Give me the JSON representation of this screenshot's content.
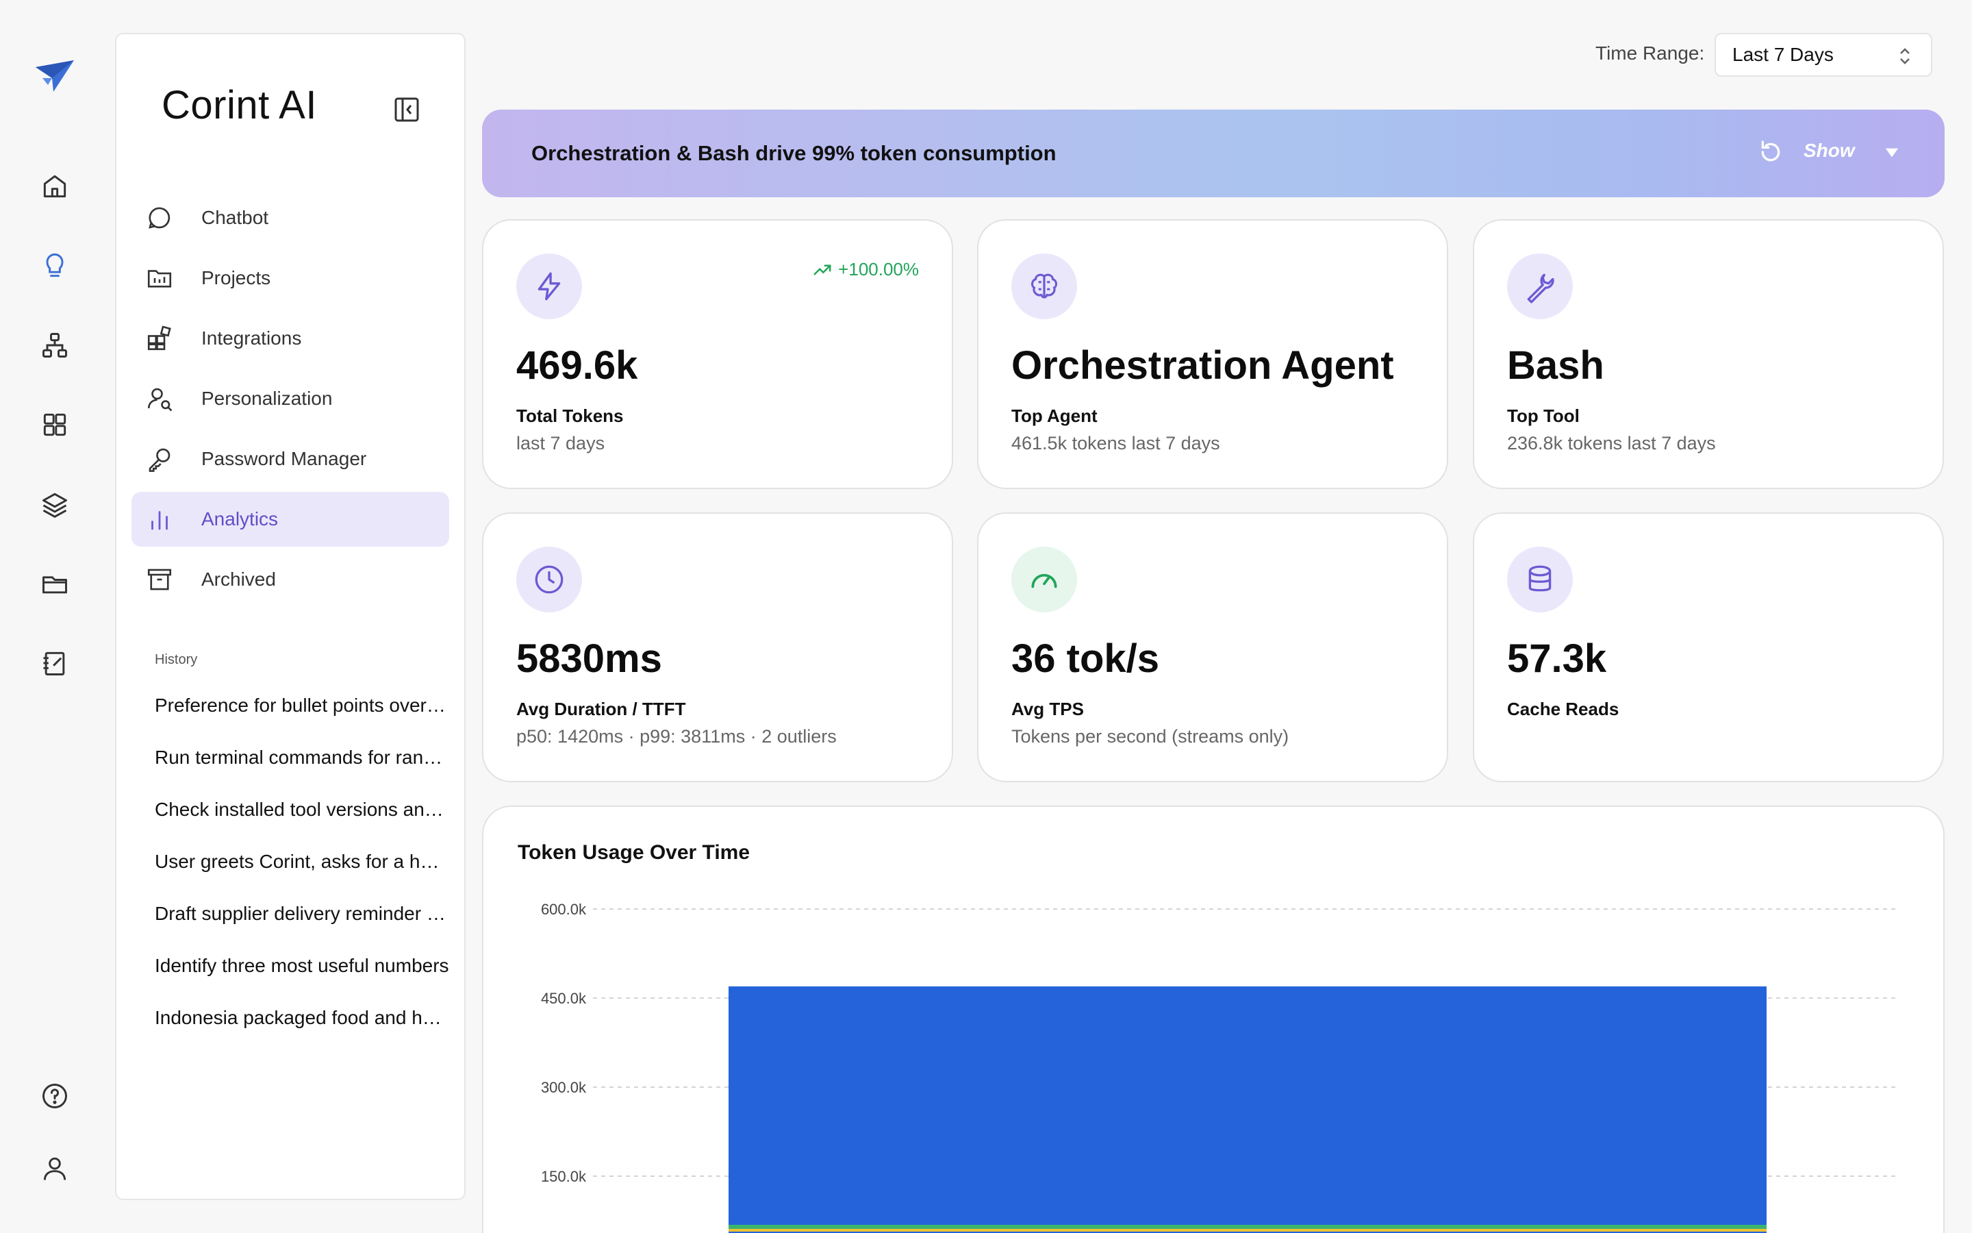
{
  "rail": {
    "items": [
      {
        "name": "home"
      },
      {
        "name": "lightbulb"
      },
      {
        "name": "sitemap"
      },
      {
        "name": "grid"
      },
      {
        "name": "layers"
      },
      {
        "name": "folder"
      },
      {
        "name": "notebook"
      }
    ]
  },
  "sidebar": {
    "brand": "Corint AI",
    "nav": [
      {
        "label": "Chatbot",
        "icon": "chat-icon",
        "active": false
      },
      {
        "label": "Projects",
        "icon": "folder-chart-icon",
        "active": false
      },
      {
        "label": "Integrations",
        "icon": "integrations-icon",
        "active": false
      },
      {
        "label": "Personalization",
        "icon": "user-search-icon",
        "active": false
      },
      {
        "label": "Password Manager",
        "icon": "key-icon",
        "active": false
      },
      {
        "label": "Analytics",
        "icon": "bar-chart-icon",
        "active": true
      },
      {
        "label": "Archived",
        "icon": "archive-icon",
        "active": false
      }
    ],
    "history_title": "History",
    "history": [
      "Preference for bullet points over paragraphs",
      "Run terminal commands for random checks",
      "Check installed tool versions and paths",
      "User greets Corint, asks for a haiku",
      "Draft supplier delivery reminder email",
      "Identify three most useful numbers",
      "Indonesia packaged food and health trends"
    ]
  },
  "header": {
    "time_range_label": "Time Range:",
    "time_range_value": "Last 7 Days"
  },
  "banner": {
    "text": "Orchestration & Bash drive 99% token consumption",
    "show_label": "Show"
  },
  "cards": [
    {
      "value": "469.6k",
      "title": "Total Tokens",
      "sub": "last 7 days",
      "trend": "+100.00%",
      "icon": "bolt-icon"
    },
    {
      "value": "Orchestration Agent",
      "title": "Top Agent",
      "sub": "461.5k tokens last 7 days",
      "icon": "brain-icon"
    },
    {
      "value": "Bash",
      "title": "Top Tool",
      "sub": "236.8k tokens last 7 days",
      "icon": "wrench-icon"
    },
    {
      "value": "5830ms",
      "title": "Avg Duration / TTFT",
      "sub": "p50: 1420ms · p99: 3811ms · 2 outliers",
      "icon": "clock-icon"
    },
    {
      "value": "36 tok/s",
      "title": "Avg TPS",
      "sub": "Tokens per second (streams only)",
      "icon": "speedometer-icon"
    },
    {
      "value": "57.3k",
      "title": "Cache Reads",
      "sub": "",
      "icon": "database-icon"
    }
  ],
  "colors": {
    "accent": "#6b5bd2",
    "accent_bg": "#ebe7fb",
    "green": "#22a55a",
    "green_bg": "#e6f6ec",
    "bar_blue": "#2563da",
    "bar_green": "#3cb46e",
    "bar_yellow": "#f1c232"
  },
  "chart_data": {
    "type": "area",
    "title": "Token Usage Over Time",
    "y_ticks": [
      "600.0k",
      "450.0k",
      "300.0k",
      "150.0k"
    ],
    "ylim": [
      0,
      600000
    ],
    "grid": true,
    "series": [
      {
        "color": "#2563da",
        "value": 469600
      }
    ]
  }
}
